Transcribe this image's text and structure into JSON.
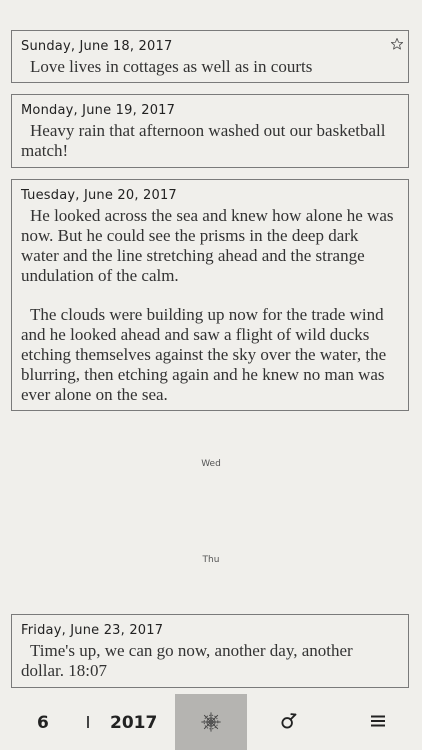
{
  "entries": [
    {
      "date": "Sunday, June 18, 2017",
      "paragraphs": [
        "Love lives in cottages as well as in courts"
      ],
      "starred": false
    },
    {
      "date": "Monday, June 19, 2017",
      "paragraphs": [
        "Heavy rain that afternoon washed out our basketball match!"
      ]
    },
    {
      "date": "Tuesday, June 20, 2017",
      "paragraphs": [
        "He looked across the sea and knew how alone he was now. But he could see the prisms in the deep dark water and the line stretching ahead and the strange undulation of the calm.",
        "The clouds were building up now for the trade wind and he looked ahead and saw a flight of wild ducks etching themselves against the sky over the water, the blurring, then etching again and he knew no man was ever alone on the sea."
      ]
    },
    {
      "date": "Friday, June 23, 2017",
      "paragraphs": [
        "Time's up, we can go now, another day, another dollar. 18:07"
      ]
    }
  ],
  "empty_days": {
    "wed": "Wed",
    "thu": "Thu"
  },
  "tabbar": {
    "month": "6",
    "year": "2017",
    "icons": {
      "compass": "compass-icon",
      "gender": "male-symbol-icon",
      "menu": "hamburger-menu-icon",
      "favorite": "star-outline-icon"
    },
    "active_tab_color": "#b5b4b1"
  },
  "colors": {
    "background": "#f0efeb",
    "border": "#7a7a7a",
    "text": "#2a2a2a"
  }
}
